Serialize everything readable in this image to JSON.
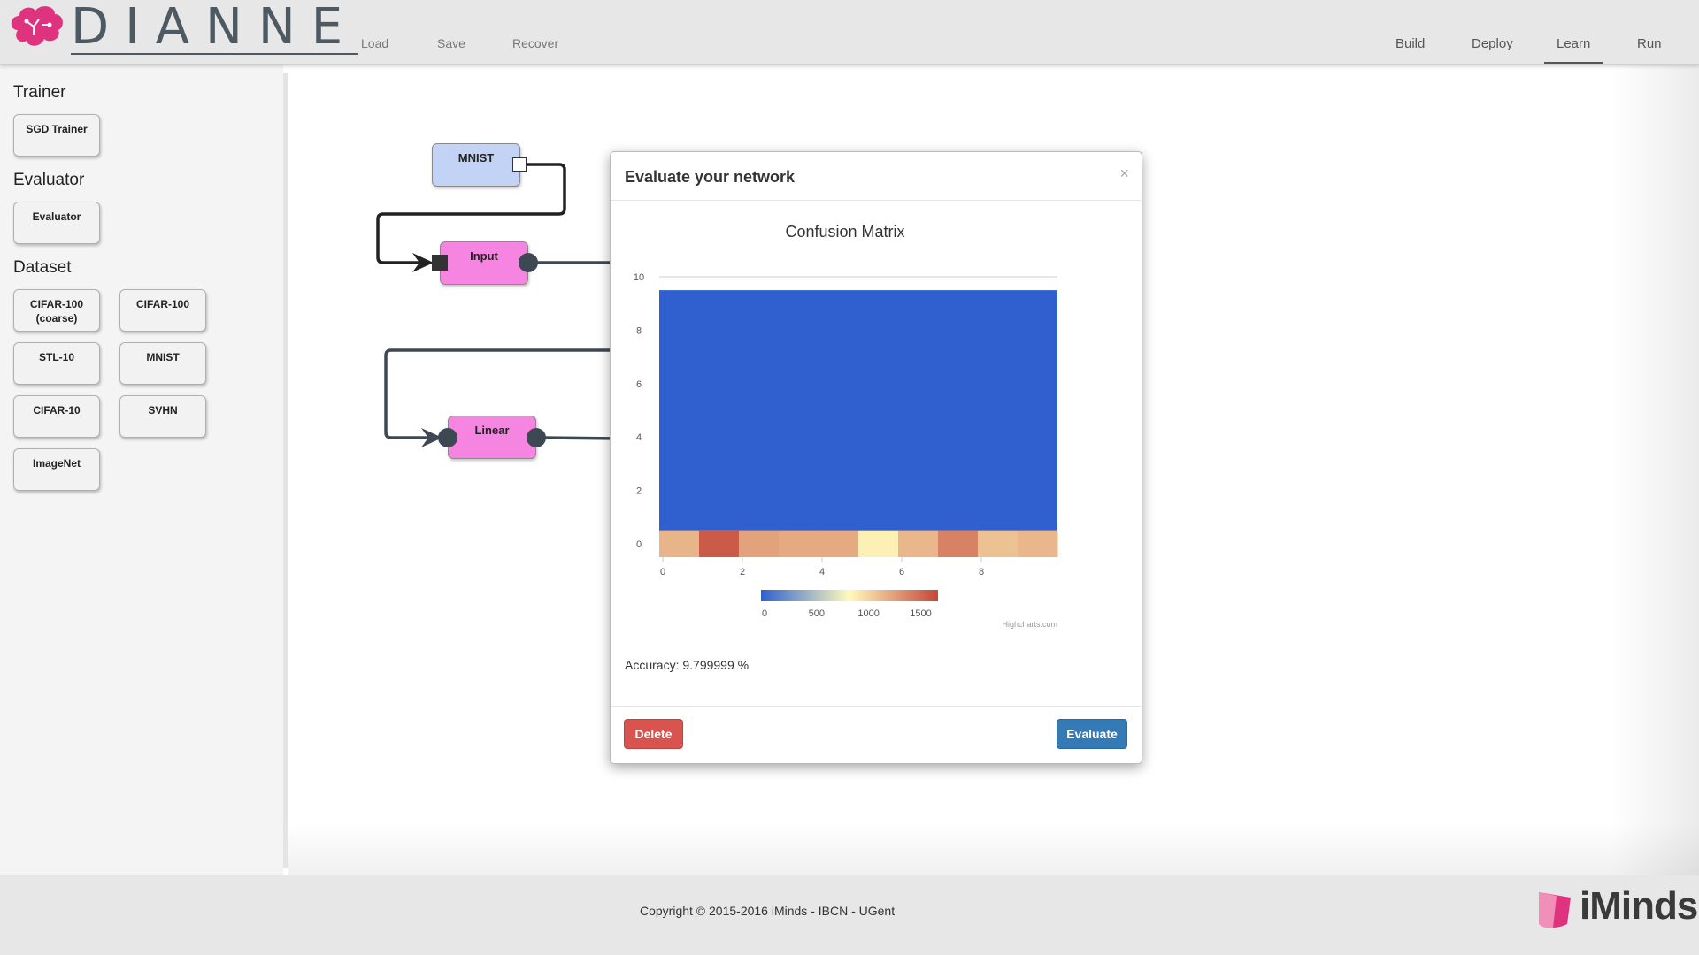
{
  "app": {
    "logo_text": "DIANNE",
    "brand_color": "#e0337f"
  },
  "nav": {
    "left": [
      "Load",
      "Save",
      "Recover"
    ],
    "right": [
      "Build",
      "Deploy",
      "Learn",
      "Run"
    ],
    "active": "Learn"
  },
  "sidebar": {
    "sections": [
      {
        "title": "Trainer",
        "items": [
          "SGD Trainer"
        ]
      },
      {
        "title": "Evaluator",
        "items": [
          "Evaluator"
        ]
      },
      {
        "title": "Dataset",
        "items": [
          "CIFAR-100 (coarse)",
          "CIFAR-100",
          "STL-10",
          "MNIST",
          "CIFAR-10",
          "SVHN",
          "ImageNet"
        ]
      }
    ]
  },
  "canvas": {
    "nodes": {
      "mnist": "MNIST",
      "input": "Input",
      "linear": "Linear"
    },
    "colors": {
      "dataset": "#c3d3f6",
      "module": "#f585e0",
      "wire": "#3e4853"
    }
  },
  "modal": {
    "title": "Evaluate your network",
    "close_symbol": "×",
    "accuracy": "Accuracy: 9.799999 %",
    "delete_label": "Delete",
    "evaluate_label": "Evaluate",
    "credits": "Highcharts.com"
  },
  "chart_data": {
    "type": "heatmap",
    "title": "Confusion Matrix",
    "x_ticks": [
      0,
      2,
      4,
      6,
      8
    ],
    "y_ticks": [
      0,
      2,
      4,
      6,
      8,
      10
    ],
    "xlim": [
      0,
      9
    ],
    "ylim": [
      0,
      10
    ],
    "colorAxis": {
      "min": 0,
      "max": 1700,
      "ticks": [
        0,
        500,
        1000,
        1500
      ],
      "stops": [
        "#3060cf",
        "#fffbbc",
        "#c4463a"
      ]
    },
    "row0": [
      1180,
      1600,
      1270,
      1230,
      1230,
      900,
      1170,
      1420,
      1120,
      1170
    ],
    "upper_rows_value": 0
  },
  "footer": {
    "copyright": "Copyright © 2015-2016 iMinds - IBCN - UGent",
    "brand": "iMinds"
  }
}
